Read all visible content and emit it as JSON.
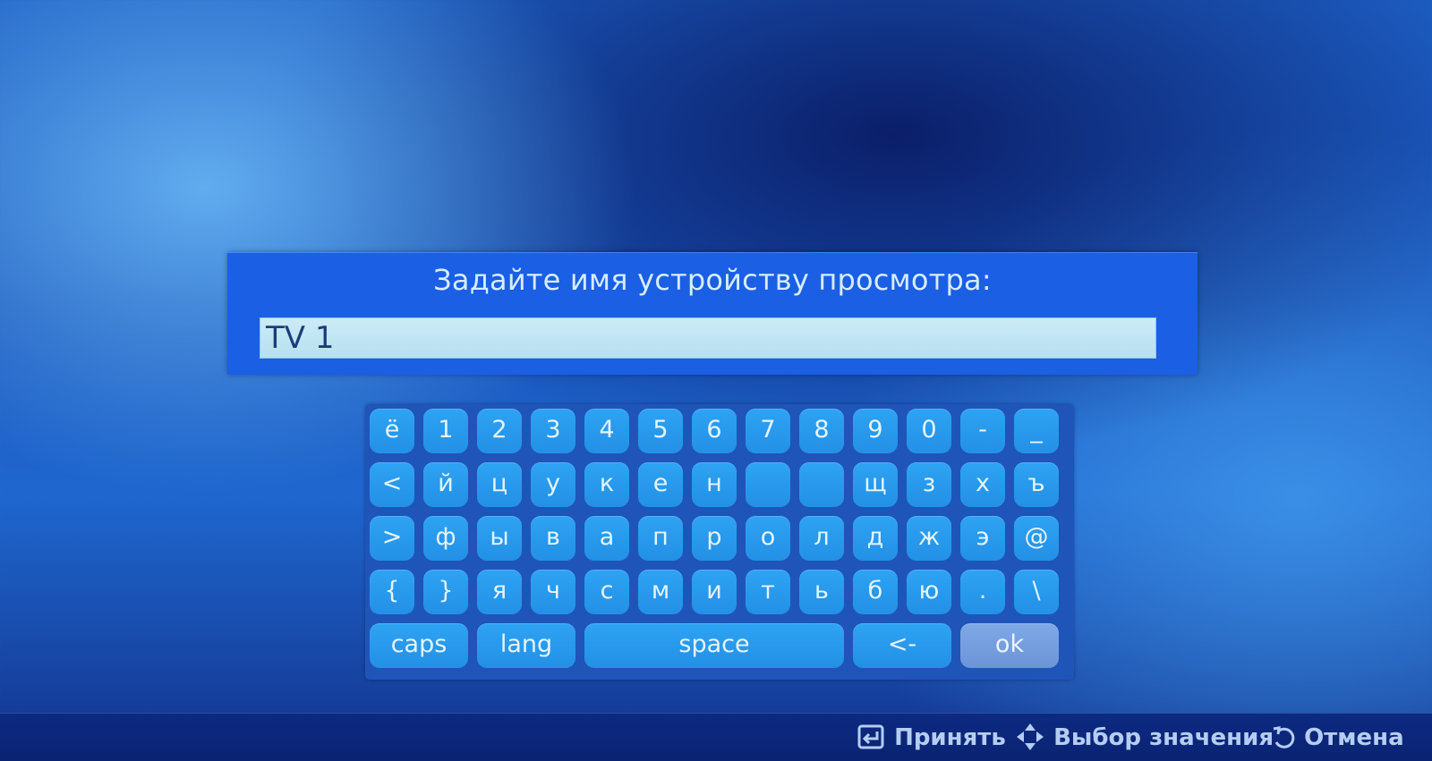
{
  "dialog": {
    "title": "Задайте имя устройству просмотра:",
    "name_value": "TV 1"
  },
  "keyboard": {
    "rows": [
      [
        "ё",
        "1",
        "2",
        "3",
        "4",
        "5",
        "6",
        "7",
        "8",
        "9",
        "0",
        "-",
        "_"
      ],
      [
        "<",
        "й",
        "ц",
        "у",
        "к",
        "е",
        "н",
        "",
        "",
        "щ",
        "з",
        "х",
        "ъ"
      ],
      [
        ">",
        "ф",
        "ы",
        "в",
        "а",
        "п",
        "р",
        "о",
        "л",
        "д",
        "ж",
        "э",
        "@"
      ],
      [
        "{",
        "}",
        "я",
        "ч",
        "с",
        "м",
        "и",
        "т",
        "ь",
        "б",
        "ю",
        ".",
        "\\"
      ]
    ],
    "bottom_row": [
      {
        "id": "caps",
        "label": "caps",
        "span": 2
      },
      {
        "id": "lang",
        "label": "lang",
        "span": 2
      },
      {
        "id": "space",
        "label": "space",
        "span": 5
      },
      {
        "id": "backspace",
        "label": "<-",
        "span": 2
      },
      {
        "id": "ok",
        "label": "ok",
        "span": 2,
        "selected": true
      }
    ]
  },
  "help_bar": {
    "accept": {
      "label": "Принять",
      "icon": "enter-icon"
    },
    "select_value": {
      "label": "Выбор значения",
      "icon": "dpad-arrows-icon"
    },
    "cancel": {
      "label": "Отмена",
      "icon": "return-arrow-icon"
    }
  },
  "colors": {
    "dialog_bg": "#1a5fe4",
    "key_bg": "#2390e6",
    "key_selected_bg": "#6c95d8",
    "help_bar_bg": "#0d2a82"
  }
}
